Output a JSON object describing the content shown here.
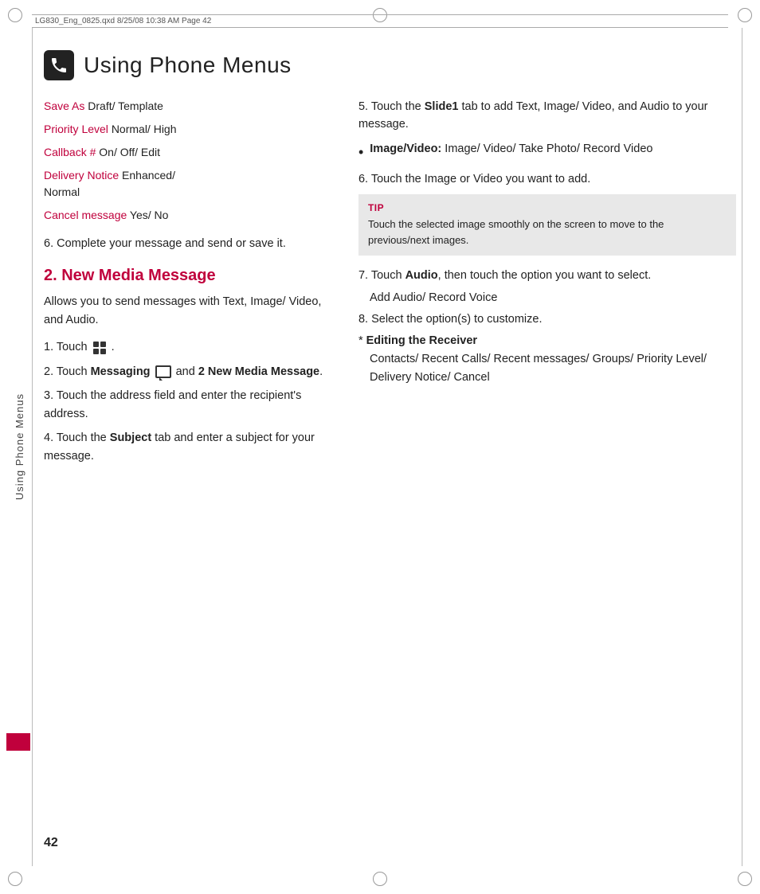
{
  "meta": {
    "top_bar": "LG830_Eng_0825.qxd   8/25/08  10:38 AM   Page 42",
    "page_number": "42",
    "sidebar_text": "Using Phone Menus"
  },
  "header": {
    "title": "Using Phone Menus"
  },
  "left_col": {
    "settings": [
      {
        "label": "Save As",
        "value": " Draft/ Template"
      },
      {
        "label": "Priority Level",
        "value": " Normal/ High"
      },
      {
        "label": "Callback #",
        "value": "  On/ Off/ Edit"
      },
      {
        "label": "Delivery Notice",
        "value": " Enhanced/ Normal"
      },
      {
        "label": "Cancel message",
        "value": " Yes/ No"
      }
    ],
    "complete_msg": "6. Complete your message and send or save it.",
    "section_heading": "2. New Media Message",
    "section_desc": "Allows you to send messages with Text, Image/ Video, and Audio.",
    "steps": [
      {
        "num": "1.",
        "text": "Touch "
      },
      {
        "num": "2.",
        "text": "Touch Messaging  and 2 New Media Message."
      },
      {
        "num": "3.",
        "text": "Touch the address field and enter the recipient's address."
      },
      {
        "num": "4.",
        "text": "Touch the Subject tab and enter a subject for your message."
      }
    ]
  },
  "right_col": {
    "step5": "5. Touch the Slide1 tab to add Text, Image/ Video, and Audio to your message.",
    "bullet": {
      "label": "Image/Video:",
      "value": " Image/ Video/ Take Photo/ Record Video"
    },
    "step6": "6. Touch the Image or Video you want to add.",
    "tip": {
      "label": "TIP",
      "text": "Touch the selected image smoothly on the screen to move to the previous/next images."
    },
    "step7": "7.  Touch Audio, then touch the option you want to select.",
    "add_audio": "Add Audio/ Record Voice",
    "step8": "8. Select the option(s) to customize.",
    "editing": {
      "star": "*",
      "heading": "Editing the Receiver",
      "options": "Contacts/ Recent Calls/ Recent messages/ Groups/ Priority Level/ Delivery Notice/ Cancel"
    }
  }
}
